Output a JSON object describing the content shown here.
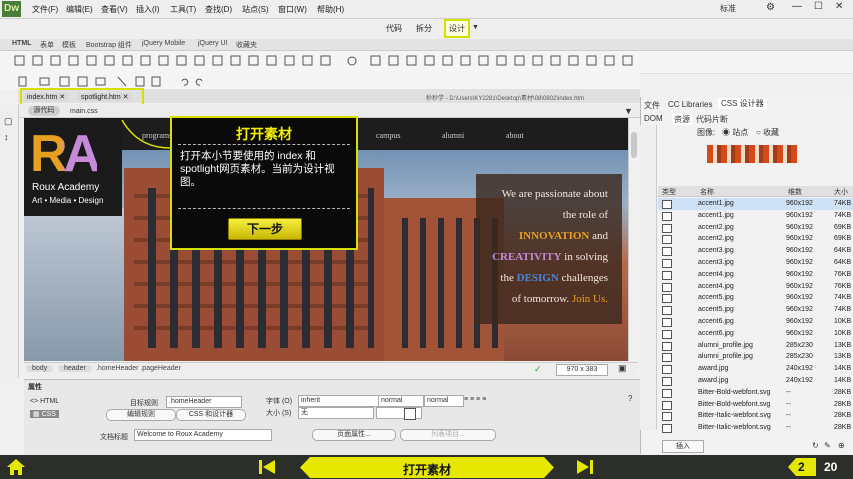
{
  "app": {
    "logo": "Dw",
    "workspace": "标准"
  },
  "menu": [
    "文件(F)",
    "编辑(E)",
    "查看(V)",
    "插入(I)",
    "工具(T)",
    "查找(D)",
    "站点(S)",
    "窗口(W)",
    "帮助(H)"
  ],
  "view_buttons": {
    "code": "代码",
    "split": "拆分",
    "design": "设计"
  },
  "category_tabs": [
    "HTML",
    "表单",
    "模板",
    "Bootstrap 组件",
    "jQuery Mobile",
    "jQuery UI",
    "收藏夹"
  ],
  "doc_tabs": [
    "index.htm",
    "spotlight.htm"
  ],
  "file_path": "秒秒学 - D:\\Users\\KY2281\\Desktop\\素材\\08\\0802\\index.htm",
  "related_files": {
    "source": "源代码",
    "css": "main.css"
  },
  "site_nav": [
    "programs",
    "campus",
    "alumni",
    "about"
  ],
  "hero_text": [
    {
      "text": "We are passionate about",
      "color": "#f2e8de"
    },
    {
      "text": "the role of",
      "color": "#f2e8de"
    },
    {
      "pre": "",
      "hl": "INNOVATION",
      "post": " and",
      "hl_color": "#e8a020"
    },
    {
      "pre": "",
      "hl": "CREATIVITY",
      "post": " in solving",
      "hl_color": "#c58ad8"
    },
    {
      "pre": "the ",
      "hl": "DESIGN",
      "post": " challenges",
      "hl_color": "#4a86d8"
    },
    {
      "pre": "of tomorrow. ",
      "hl": "Join Us.",
      "post": "",
      "hl_color": "#e8a020"
    }
  ],
  "logo": {
    "letters": "RA",
    "name": "Roux Academy",
    "tagline": "Art • Media • Design"
  },
  "callout": {
    "title": "打开素材",
    "body": "打开本小节要使用的 index 和 spotlight网页素材。当前为设计视图。",
    "next_button": "下一步"
  },
  "tag_selector": [
    "body",
    "header",
    ".homeHeader .pageHeader"
  ],
  "window_size": "970 x 383",
  "properties": {
    "panel_title": "属性",
    "html_btn": "HTML",
    "css_btn": "CSS",
    "target_rule_label": "目标规则",
    "target_rule_value": ".homeHeader",
    "edit_rule": "编辑规则",
    "css_designer": "CSS 和设计器",
    "font_label": "字体 (O)",
    "font_value": "inherit",
    "weight_value": "normal",
    "style_value": "normal",
    "size_label": "大小 (S)",
    "size_value": "无",
    "doc_title_label": "文档标题",
    "doc_title_value": "Welcome to Roux Academy",
    "page_props": "页面属性...",
    "list_item": "列表项目..."
  },
  "right_panel": {
    "top_tabs": [
      "文件",
      "CC Libraries",
      "CSS 设计器"
    ],
    "sub_tabs": [
      "DOM",
      "资源",
      "代码片断"
    ],
    "image_label": "图像:",
    "radio_site": "站点",
    "radio_fav": "收藏",
    "col_type": "类型",
    "col_name": "名称",
    "col_dim": "维数",
    "col_size": "大小",
    "insert_button": "插入",
    "files": [
      {
        "name": "accent1.jpg",
        "dim": "960x192",
        "size": "74KB"
      },
      {
        "name": "accent1.jpg",
        "dim": "960x192",
        "size": "74KB"
      },
      {
        "name": "accent2.jpg",
        "dim": "960x192",
        "size": "69KB"
      },
      {
        "name": "accent2.jpg",
        "dim": "960x192",
        "size": "69KB"
      },
      {
        "name": "accent3.jpg",
        "dim": "960x192",
        "size": "64KB"
      },
      {
        "name": "accent3.jpg",
        "dim": "960x192",
        "size": "64KB"
      },
      {
        "name": "accent4.jpg",
        "dim": "960x192",
        "size": "76KB"
      },
      {
        "name": "accent4.jpg",
        "dim": "960x192",
        "size": "76KB"
      },
      {
        "name": "accent5.jpg",
        "dim": "960x192",
        "size": "74KB"
      },
      {
        "name": "accent5.jpg",
        "dim": "960x192",
        "size": "74KB"
      },
      {
        "name": "accent6.jpg",
        "dim": "960x192",
        "size": "10KB"
      },
      {
        "name": "accent6.jpg",
        "dim": "960x192",
        "size": "10KB"
      },
      {
        "name": "alumni_profile.jpg",
        "dim": "285x230",
        "size": "13KB"
      },
      {
        "name": "alumni_profile.jpg",
        "dim": "285x230",
        "size": "13KB"
      },
      {
        "name": "award.jpg",
        "dim": "240x192",
        "size": "14KB"
      },
      {
        "name": "award.jpg",
        "dim": "240x192",
        "size": "14KB"
      },
      {
        "name": "Bitter-Bold-webfont.svg",
        "dim": "--",
        "size": "28KB"
      },
      {
        "name": "Bitter-Bold-webfont.svg",
        "dim": "--",
        "size": "28KB"
      },
      {
        "name": "Bitter-Italic-webfont.svg",
        "dim": "--",
        "size": "28KB"
      },
      {
        "name": "Bitter-Italic-webfont.svg",
        "dim": "--",
        "size": "28KB"
      }
    ]
  },
  "bottom_bar": {
    "title": "打开素材",
    "current_page": "2",
    "total_pages": "20"
  },
  "colors": {
    "highlight": "#d6e000",
    "bar_bg": "#2c2e2a",
    "bar_yellow": "#e6e800"
  }
}
